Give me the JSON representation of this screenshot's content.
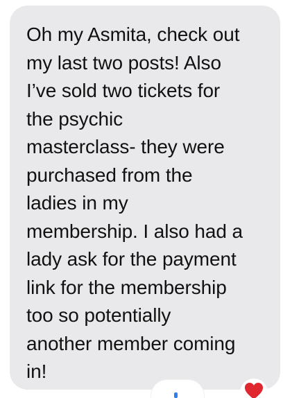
{
  "message": {
    "lines": [
      "Oh my Asmita, check out",
      "my last two posts! Also",
      "I’ve sold two tickets for",
      "the psychic",
      "masterclass- they were",
      "purchased from the",
      "ladies in my",
      "membership. I also had a",
      "lady ask for the payment",
      "link for the membership",
      "too so potentially",
      "another member coming",
      "in!"
    ],
    "bubble_color": "#e9e9eb",
    "text_color": "#111111"
  },
  "reactions": {
    "heart_icon": "heart-icon",
    "heart_color": "#e0262f",
    "other_icon": "reaction-icon"
  }
}
